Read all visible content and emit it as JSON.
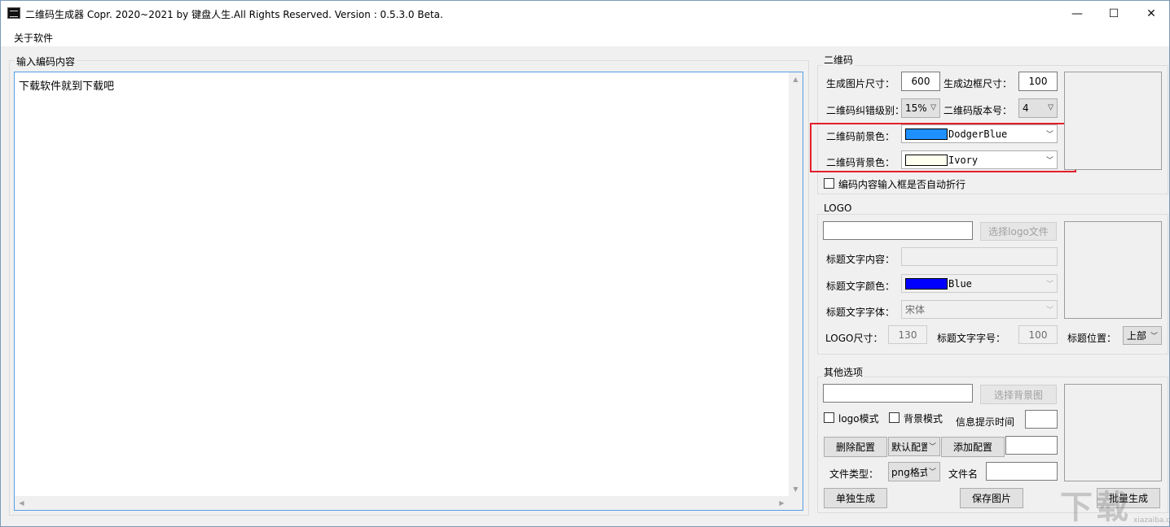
{
  "window": {
    "title": "二维码生成器  Copr. 2020~2021 by 键盘人生.All Rights Reserved.  Version : 0.5.3.0 Beta.",
    "minimize": "—",
    "maximize": "☐",
    "close": "✕"
  },
  "menu": {
    "about": "关于软件"
  },
  "input_group": {
    "label": "输入编码内容",
    "content": "下载软件就到下载吧"
  },
  "qr_group": {
    "label": "二维码",
    "image_size_label": "生成图片尺寸：",
    "image_size": "600",
    "border_size_label": "生成边框尺寸：",
    "border_size": "100",
    "ecc_label": "二维码纠错级别：",
    "ecc": "15%",
    "version_label": "二维码版本号：",
    "version": "4",
    "fg_label": "二维码前景色：",
    "fg_color_name": "DodgerBlue",
    "fg_color": "#1e90ff",
    "bg_label": "二维码背景色：",
    "bg_color_name": "Ivory",
    "bg_color": "#fffff0",
    "wrap_label": "编码内容输入框是否自动折行"
  },
  "logo_group": {
    "label": "LOGO",
    "choose_logo": "选择logo文件",
    "title_text_label": "标题文字内容：",
    "title_color_label": "标题文字颜色：",
    "title_color_name": "Blue",
    "title_color": "#0000ff",
    "title_font_label": "标题文字字体：",
    "title_font": "宋体",
    "logo_size_label": "LOGO尺寸：",
    "logo_size": "130",
    "title_font_size_label": "标题文字字号：",
    "title_font_size": "100",
    "title_pos_label": "标题位置：",
    "title_pos": "上部"
  },
  "other_group": {
    "label": "其他选项",
    "choose_bg": "选择背景图",
    "logo_mode": "logo模式",
    "bg_mode": "背景模式",
    "tip_time_label": "信息提示时间",
    "delete_config": "删除配置",
    "config_select": "默认配置",
    "add_config": "添加配置",
    "file_type_label": "文件类型：",
    "file_type": "png格式",
    "file_name_label": "文件名"
  },
  "actions": {
    "single": "单独生成",
    "save": "保存图片",
    "batch": "批量生成"
  },
  "watermark": {
    "main": "下载",
    "sub": "xiazaiba.com"
  },
  "colors": {
    "accent": "#569de5",
    "highlight": "#e41e2b"
  }
}
